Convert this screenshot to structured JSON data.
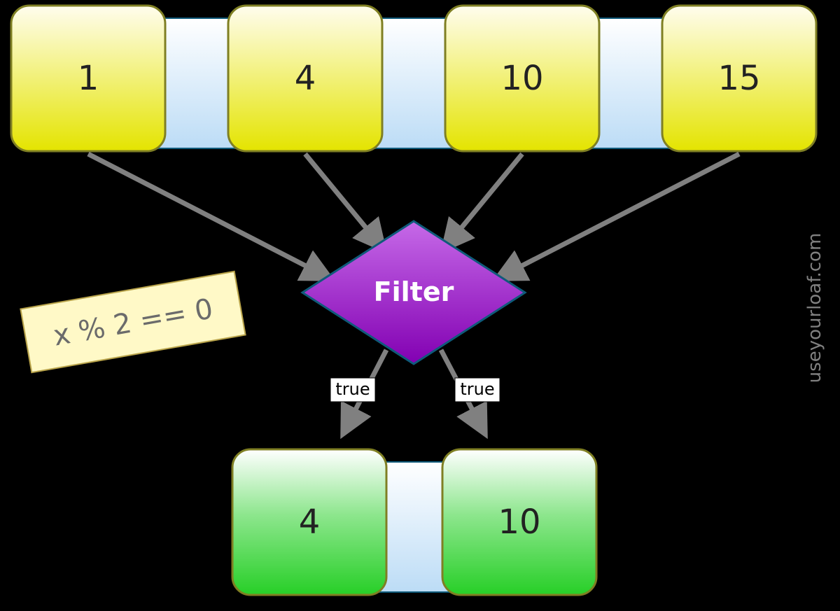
{
  "input_strip_color_top": "#ffffff",
  "input_strip_color_bottom": "#bcdcf6",
  "output_strip_color_top": "#ffffff",
  "output_strip_color_bottom": "#bcdcf6",
  "cell_stroke": "#7f7f23",
  "cell_fill_top": "#fffdee",
  "cell_fill_bottom": "#e4e400",
  "out_fill_top": "#ffffff",
  "out_fill_bottom": "#27cf27",
  "diamond_fill_top": "#c66ae8",
  "diamond_fill_bottom": "#8200b2",
  "diamond_stroke": "#0f5a7a",
  "note_fill": "#fff9c7",
  "note_stroke": "#b8a34a",
  "arrow_stroke": "#808080",
  "inputs": [
    "1",
    "4",
    "10",
    "15"
  ],
  "operation": "Filter",
  "predicate": "x % 2 == 0",
  "edge_labels": [
    "true",
    "true"
  ],
  "outputs": [
    "4",
    "10"
  ],
  "credit": "useyourloaf.com"
}
